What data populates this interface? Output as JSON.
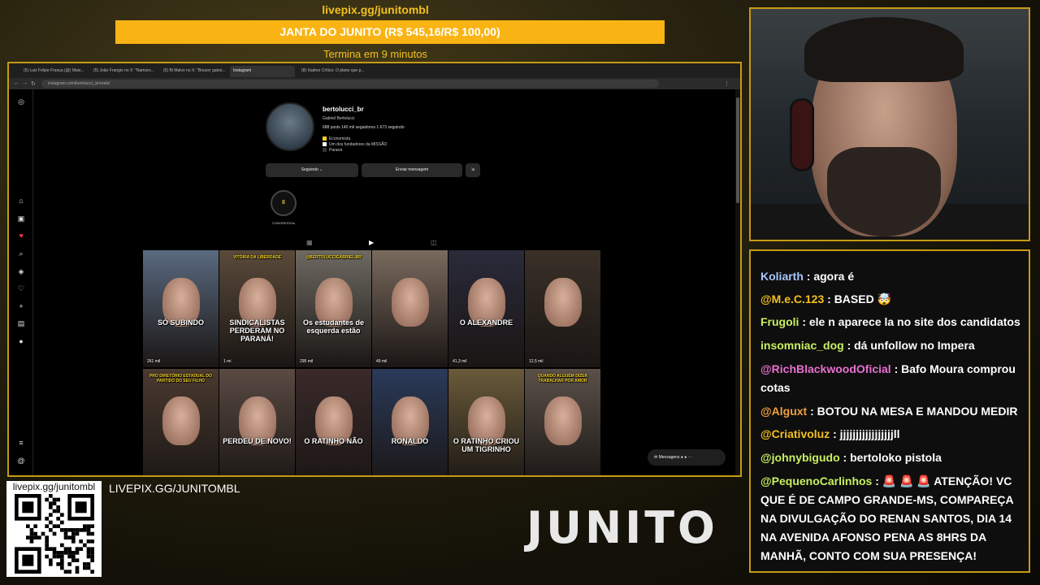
{
  "overlay": {
    "top_url": "livepix.gg/junitombl",
    "goal_text": "JANTA DO JUNITO (R$ 545,16/R$ 100,00)",
    "goal_sub": "Termina em 9 minutos",
    "qr_label": "livepix.gg/junitombl",
    "bottom_url": "LIVEPIX.GG/JUNITOMBL",
    "logo": "JUNITO"
  },
  "browser": {
    "tabs": [
      {
        "label": "(5) Luiz Felipe França (@) Mais..."
      },
      {
        "label": "(5) João Frangio no X: \"Namoro..."
      },
      {
        "label": "(5) Bi Malvo no X: \"Boucer gatos..."
      },
      {
        "label": "Instagram"
      },
      {
        "label": "(8) Xadrez Crítico: O plano que p..."
      }
    ],
    "url": "instagram.com/bertolucci_br/reels/"
  },
  "profile": {
    "username": "bertolucci_br",
    "full_name": "Gabriel Bertolucci",
    "stats": "688 posts   140 mil seguidores   1.673 seguindo",
    "bio": [
      "Economista",
      "Um dos fundadores da MISSÃO",
      "Paraná"
    ],
    "btn_follow": "Seguindo ⌄",
    "btn_message": "Enviar mensagem",
    "highlight": "CONGRESSOs",
    "highlight_badge": "8"
  },
  "reels": [
    {
      "caption": "SÓ SUBINDO",
      "views": "261 mil",
      "bg": "#5a6a80"
    },
    {
      "caption": "SINDICALISTAS PERDERAM NO PARANÁ!",
      "views": "1 mi",
      "bg": "#5a4a3a",
      "top": "VITÓRIA DA LIBERDADE"
    },
    {
      "caption": "Os estudantes de esquerda estão",
      "views": "295 mil",
      "bg": "#6e6a62",
      "top": "@BERTOLUCCIGABRIEL.BR"
    },
    {
      "caption": "",
      "views": "49 mil",
      "bg": "#7a6a5e"
    },
    {
      "caption": "O ALEXANDRE",
      "views": "41,3 mil",
      "bg": "#2a2a3a"
    },
    {
      "caption": "",
      "views": "12,5 mil",
      "bg": "#3a3028"
    },
    {
      "caption": "",
      "views": "",
      "bg": "#4a3a30",
      "top": "PRO DIRETÓRIO ESTADUAL DO PARTIDO DO SEU FILHO"
    },
    {
      "caption": "PERDEU DE NOVO!",
      "views": "",
      "bg": "#5a4a44"
    },
    {
      "caption": "O RATINHO NÃO",
      "views": "",
      "bg": "#3a2a2a"
    },
    {
      "caption": "RONALDO",
      "views": "",
      "bg": "#2a3a5a"
    },
    {
      "caption": "O RATINHO CRIOU UM TIGRINHO",
      "views": "",
      "bg": "#6a5a3a"
    },
    {
      "caption": "",
      "views": "",
      "bg": "#5a5048",
      "top": "QUANDO ALGUÉM DIZER TRABALHAR POR AMOR"
    }
  ],
  "messages_pill": "Mensagens",
  "chat": [
    {
      "user": "Koliarth",
      "color": "#a8c6ff",
      "text": ": agora é"
    },
    {
      "user": "@M.e.C.123",
      "color": "#f2c020",
      "text": ": BASED 🤯"
    },
    {
      "user": "Frugoli",
      "color": "#c8f060",
      "text": ": ele n aparece la no site dos candidatos"
    },
    {
      "user": "insomniac_dog",
      "color": "#c8f060",
      "text": ": dá unfollow no Impera"
    },
    {
      "user": "@RichBlackwoodOficial",
      "color": "#e870d0",
      "text": ": Bafo Moura comprou cotas"
    },
    {
      "user": "@Alguxt",
      "color": "#f0a040",
      "text": ": BOTOU NA MESA E MANDOU MEDIR"
    },
    {
      "user": "@Criativoluz",
      "color": "#f2c020",
      "text": ": jjjjjjjjjjjjjjjjjll"
    },
    {
      "user": "@johnybigudo",
      "color": "#c8f060",
      "text": ": bertoloko pistola"
    },
    {
      "user": "@PequenoCarlinhos",
      "color": "#c8f060",
      "text": ": 🚨 🚨 🚨 ATENÇÃO! VC QUE É DE CAMPO GRANDE-MS, COMPAREÇA NA DIVULGAÇÃO DO RENAN SANTOS, DIA 14 NA AVENIDA AFONSO PENA AS 8HRS DA MANHÃ, CONTO COM SUA PRESENÇA!"
    }
  ],
  "colors": {
    "accent": "#c69a16",
    "goal": "#f9b414"
  }
}
